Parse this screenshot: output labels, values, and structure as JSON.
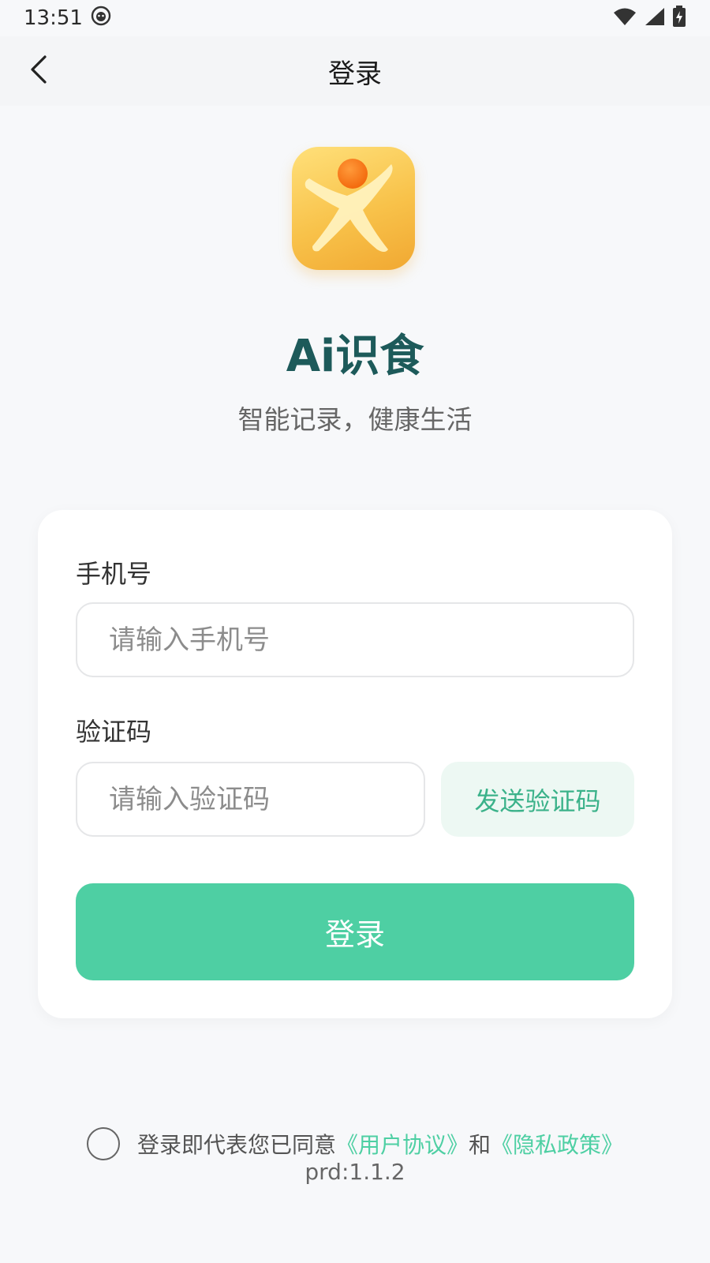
{
  "status_bar": {
    "time": "13:51",
    "notification_icon": "android-face-icon",
    "wifi_icon": "wifi-icon",
    "signal_icon": "signal-icon",
    "battery_icon": "battery-charging-icon"
  },
  "nav": {
    "back_icon": "chevron-left-icon",
    "title": "登录"
  },
  "brand": {
    "app_name": "Ai识食",
    "slogan": "智能记录，健康生活",
    "icon": "app-logo-running-figure"
  },
  "form": {
    "phone_label": "手机号",
    "phone_placeholder": "请输入手机号",
    "phone_value": "",
    "code_label": "验证码",
    "code_placeholder": "请输入验证码",
    "code_value": "",
    "send_code_label": "发送验证码",
    "login_label": "登录"
  },
  "agreement": {
    "checked": false,
    "prefix": "登录即代表您已同意",
    "user_agreement": "《用户协议》",
    "conjunction": "和",
    "privacy_policy": "《隐私政策》"
  },
  "version": "prd:1.1.2",
  "colors": {
    "accent": "#4ecfa3",
    "accent_light": "#edf8f3",
    "brand_title": "#1d5a5a",
    "background": "#f7f8fa"
  }
}
